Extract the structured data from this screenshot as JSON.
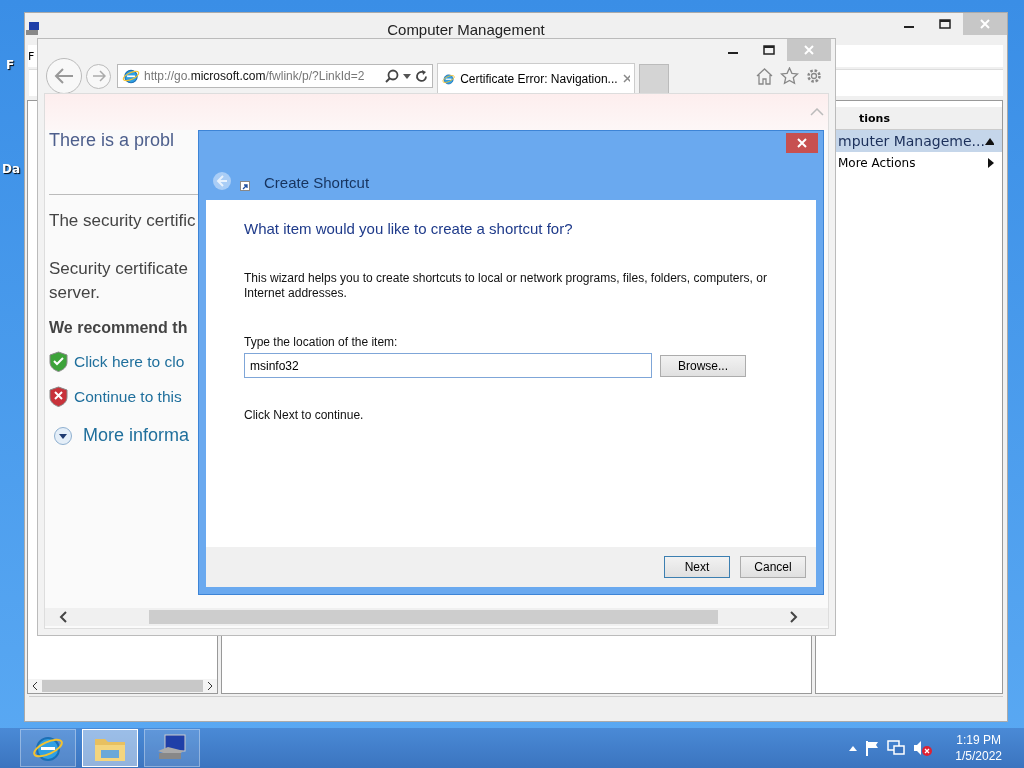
{
  "desktop": {
    "labels": [
      "F",
      "Da"
    ]
  },
  "computer_management": {
    "title": "Computer Management",
    "menu": [
      "F"
    ],
    "actions_panel": {
      "header": "tions",
      "items": [
        {
          "label": "mputer Manageme...",
          "kind": "group",
          "selected": true
        },
        {
          "label": "More Actions",
          "kind": "submenu",
          "selected": false
        }
      ]
    }
  },
  "browser": {
    "address": "http://go.**microsoft.com**/fwlink/p/?LinkId=2",
    "tabs": [
      {
        "label": "Certificate Error: Navigation...",
        "selected": true
      }
    ],
    "page": {
      "heading": "There is a probl",
      "paragraphs": [
        "The security certific",
        "Security certificate",
        "server."
      ],
      "recommend": "We recommend th",
      "links": [
        {
          "kind": "safe",
          "label": "Click here to clo"
        },
        {
          "kind": "unsafe",
          "label": "Continue to this"
        }
      ],
      "more": "More informa"
    }
  },
  "dialog": {
    "title": "Create Shortcut",
    "heading": "What item would you like to create a shortcut for?",
    "description": "This wizard helps you to create shortcuts to local or network programs, files, folders, computers, or Internet addresses.",
    "field_label": "Type the location of the item:",
    "location": {
      "value": "msinfo32"
    },
    "browse": "Browse...",
    "hint": "Click Next to continue.",
    "buttons": [
      {
        "label": "Next",
        "selected": true
      },
      {
        "label": "Cancel",
        "selected": false
      }
    ]
  },
  "taskbar": {
    "apps": [
      {
        "kind": "browser",
        "selected": false
      },
      {
        "kind": "folder",
        "selected": true
      },
      {
        "kind": "computer",
        "selected": false
      }
    ],
    "clock": {
      "time": "1:19 PM",
      "date": "1/5/2022"
    }
  }
}
